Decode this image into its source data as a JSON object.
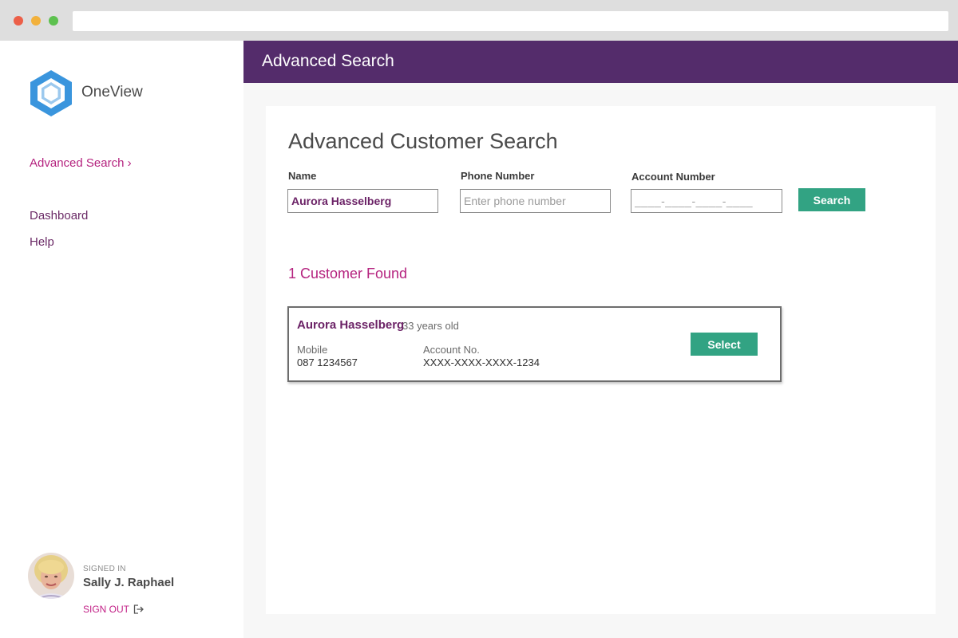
{
  "app": {
    "name": "OneView"
  },
  "sidebar": {
    "active_item": "Advanced Search ›",
    "items": [
      {
        "label": "Dashboard"
      },
      {
        "label": "Help"
      }
    ],
    "user": {
      "signed_in_label": "SIGNED IN",
      "name": "Sally J. Raphael",
      "sign_out_label": "SIGN OUT"
    }
  },
  "header": {
    "title": "Advanced Search"
  },
  "search_form": {
    "title": "Advanced Customer Search",
    "name_label": "Name",
    "name_value": "Aurora Hasselberg",
    "phone_label": "Phone Number",
    "phone_placeholder": "Enter phone number",
    "account_label": "Account Number",
    "account_placeholder": "____-____-____-____",
    "search_button": "Search"
  },
  "results": {
    "count_text": "1 Customer Found",
    "customers": [
      {
        "name": "Aurora Hasselberg",
        "age": "33 years old",
        "mobile_label": "Mobile",
        "mobile": "087 1234567",
        "account_label": "Account No.",
        "account": "XXXX-XXXX-XXXX-1234",
        "select_button": "Select"
      }
    ]
  },
  "colors": {
    "header_purple": "#542c6b",
    "accent_magenta": "#b5237f",
    "button_green": "#32a383",
    "logo_blue": "#3a95dd"
  }
}
